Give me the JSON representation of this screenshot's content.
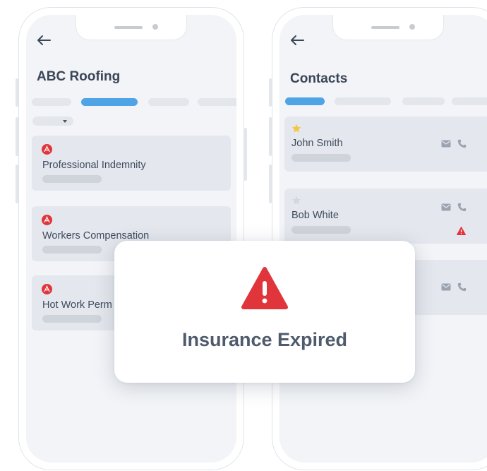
{
  "left_screen": {
    "title": "ABC Roofing",
    "cards": [
      {
        "label": "Professional Indemnity",
        "icon": "pdf-icon"
      },
      {
        "label": "Workers Compensation",
        "icon": "pdf-icon"
      },
      {
        "label": "Hot Work Perm",
        "icon": "pdf-icon"
      }
    ]
  },
  "right_screen": {
    "title": "Contacts",
    "contacts": [
      {
        "name": "John Smith",
        "starred": true,
        "warning": false
      },
      {
        "name": "Bob White",
        "starred": false,
        "warning": true
      },
      {
        "name": "",
        "starred": false,
        "warning": false
      }
    ]
  },
  "modal": {
    "message": "Insurance Expired",
    "icon": "warning-icon"
  },
  "colors": {
    "accent": "#4fa4e6",
    "danger": "#e0363b",
    "star": "#f5c542"
  }
}
